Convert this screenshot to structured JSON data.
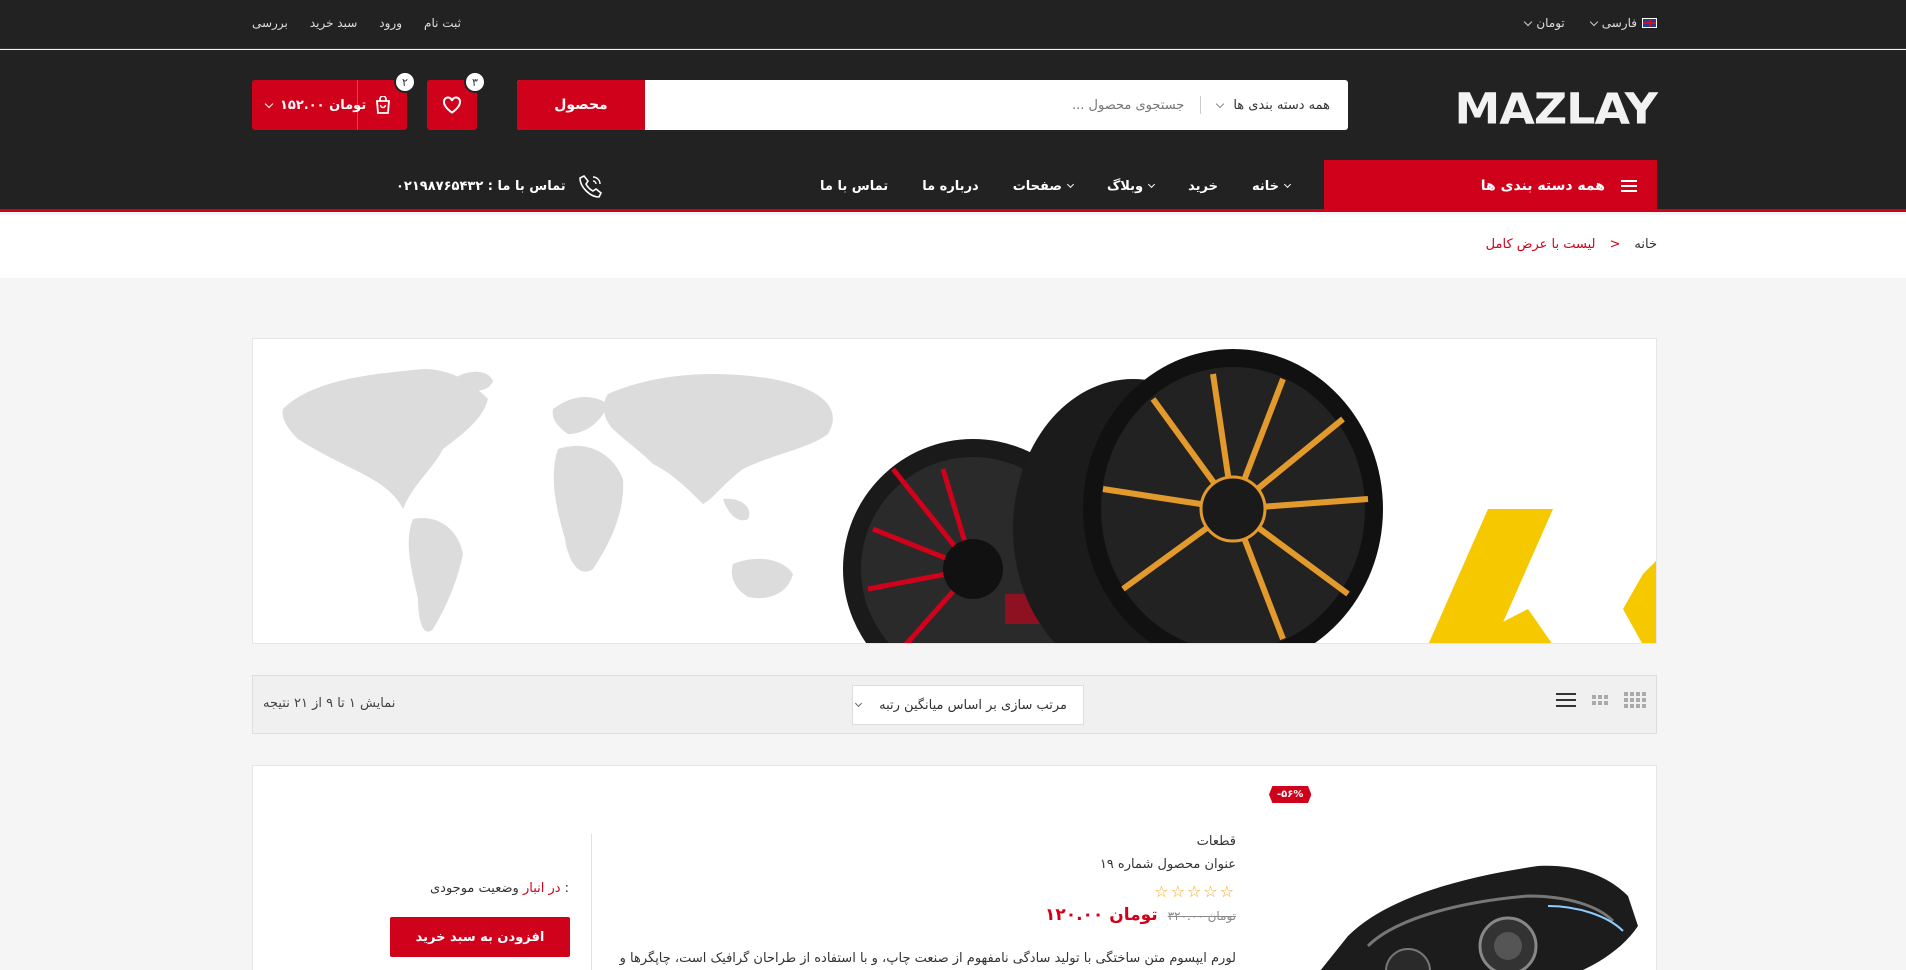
{
  "topbar": {
    "links": [
      "ثبت نام",
      "ورود",
      "سبد خرید",
      "بررسی"
    ],
    "language": "فارسی",
    "currency": "تومان"
  },
  "header": {
    "logo": "MAZLAY",
    "search_button": "محصول",
    "search_placeholder": "جستجوی محصول ...",
    "category_select": "همه دسته بندی ها",
    "wishlist_count": "۳",
    "cart_count": "۲",
    "cart_total": "۱۵۲.۰۰ تومان"
  },
  "nav": {
    "all_categories": "همه دسته بندی ها",
    "items": [
      {
        "label": "خانه",
        "dropdown": true
      },
      {
        "label": "خرید",
        "dropdown": false
      },
      {
        "label": "وبلاگ",
        "dropdown": true
      },
      {
        "label": "صفحات",
        "dropdown": true
      },
      {
        "label": "درباره ما",
        "dropdown": false
      },
      {
        "label": "تماس با ما",
        "dropdown": false
      }
    ],
    "phone_label": "تماس با ما : ۰۲۱۹۸۷۶۵۴۳۲"
  },
  "breadcrumb": {
    "home": "خانه",
    "separator": ">",
    "current": "لیست با عرض کامل"
  },
  "toolbar": {
    "result_count": "نمایش ۱ تا ۹ از ۲۱ نتیجه",
    "sort_label": "مرتب سازی بر اساس میانگین رتبه"
  },
  "product": {
    "sale_badge": "-۵۶%",
    "category": "قطعات",
    "title": "عنوان محصول شماره ۱۹",
    "stars": "☆☆☆☆☆",
    "old_price": "۳۲۰.۰۰ تومان",
    "new_price": "۱۲۰.۰۰ تومان",
    "description": "لورم ایپسوم متن ساختگی با تولید سادگی نامفهوم از صنعت چاپ، و با استفاده از طراحان گرافیک است، چاپگرها و",
    "stock_label": "وضعیت موجودی :",
    "stock_value": "در انبار",
    "add_to_cart": "افزودن به سبد خرید"
  },
  "colors": {
    "accent": "#d0021b",
    "dark": "#222222",
    "star": "#f5a623"
  }
}
